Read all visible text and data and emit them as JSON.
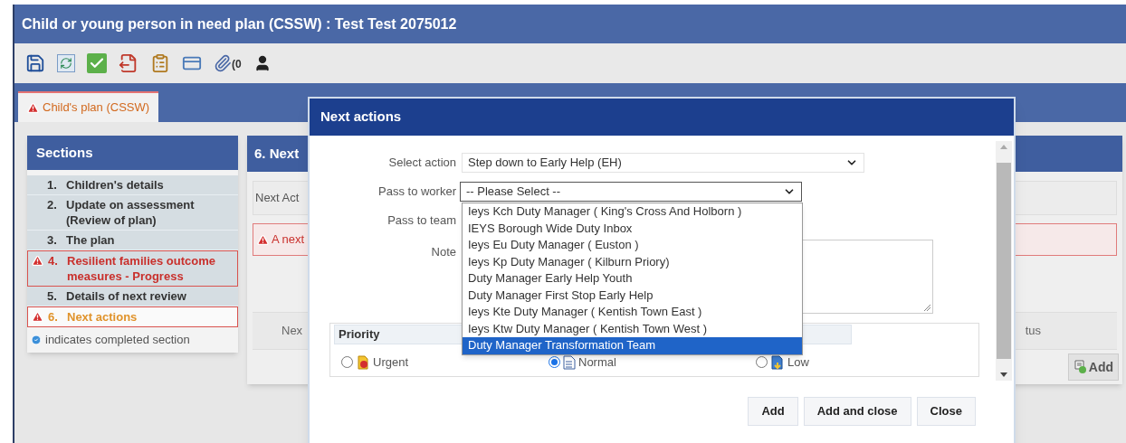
{
  "window": {
    "title": "Child or young person in need plan (CSSW) :  Test Test  2075012"
  },
  "toolbar": {
    "attachment_count": "(0"
  },
  "tabs": [
    {
      "label": "Child's plan (CSSW)",
      "selected": true,
      "warning": true
    }
  ],
  "sections": {
    "title": "Sections",
    "items": [
      {
        "number": "1.",
        "label": "Children's details",
        "warning": false,
        "selected": false
      },
      {
        "number": "2.",
        "label": "Update on assessment (Review of plan)",
        "warning": false,
        "selected": false
      },
      {
        "number": "3.",
        "label": "The plan",
        "warning": false,
        "selected": false
      },
      {
        "number": "4.",
        "label": "Resilient families outcome measures - Progress",
        "warning": true,
        "selected": false
      },
      {
        "number": "5.",
        "label": "Details of next review",
        "warning": false,
        "selected": false
      },
      {
        "number": "6.",
        "label": "Next actions",
        "warning": true,
        "selected": true
      }
    ],
    "legend": "indicates completed section"
  },
  "panel": {
    "title": "6. Next",
    "row_label": "Next Act",
    "alert": "A next",
    "column_1": "Nex",
    "column_2": "tus",
    "add_button": "Add"
  },
  "dialog": {
    "title": "Next actions",
    "fields": [
      {
        "label": "Select action",
        "kind": "select",
        "value": "Step down to Early Help (EH)",
        "focused": false
      },
      {
        "label": "Pass to worker",
        "kind": "select",
        "value": "-- Please Select --",
        "focused": true
      },
      {
        "label": "Pass to team",
        "kind": "hidden"
      },
      {
        "label": "Note",
        "kind": "textarea"
      }
    ],
    "dropdown": [
      {
        "label": "Ieys Kch Duty Manager ( King's Cross And Holborn )",
        "selected": false
      },
      {
        "label": "IEYS Borough Wide Duty Inbox",
        "selected": false
      },
      {
        "label": "Ieys Eu Duty Manager ( Euston )",
        "selected": false
      },
      {
        "label": "Ieys Kp Duty Manager ( Kilburn Priory)",
        "selected": false
      },
      {
        "label": "Duty Manager Early Help Youth",
        "selected": false
      },
      {
        "label": "Duty Manager First Stop Early Help",
        "selected": false
      },
      {
        "label": "Ieys Kte Duty Manager ( Kentish Town East )",
        "selected": false
      },
      {
        "label": "Ieys Ktw Duty Manager ( Kentish Town West )",
        "selected": false
      },
      {
        "label": "Duty Manager Transformation Team",
        "selected": true
      }
    ],
    "priority": {
      "legend": "Priority",
      "options": [
        {
          "label": "Urgent",
          "kind": "urgent",
          "selected": false
        },
        {
          "label": "Normal",
          "kind": "normal",
          "selected": true
        },
        {
          "label": "Low",
          "kind": "low",
          "selected": false
        }
      ]
    },
    "buttons": [
      "Add",
      "Add and close",
      "Close"
    ]
  }
}
